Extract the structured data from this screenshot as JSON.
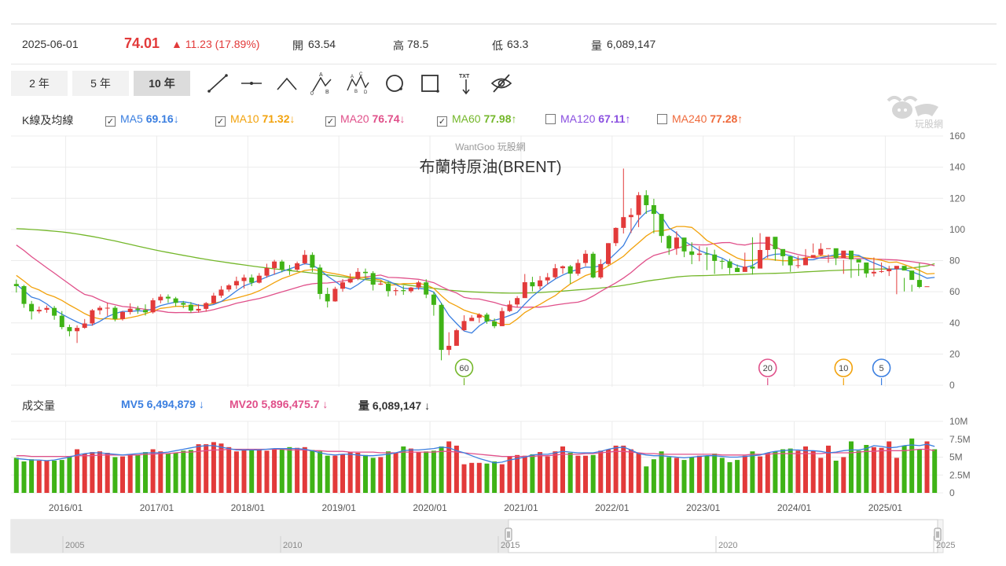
{
  "quote": {
    "date": "2025-06-01",
    "price": "74.01",
    "change": "▲ 11.23 (17.89%)",
    "open_label": "開",
    "open": "63.54",
    "high_label": "高",
    "high": "78.5",
    "low_label": "低",
    "low": "63.3",
    "vol_label": "量",
    "volume": "6,089,147"
  },
  "ranges": [
    {
      "label": "2 年",
      "active": false
    },
    {
      "label": "5 年",
      "active": false
    },
    {
      "label": "10 年",
      "active": true
    }
  ],
  "tools": [
    "line-icon",
    "horizontal-line-icon",
    "wedge-icon",
    "abc-pattern-icon",
    "abcd-pattern-icon",
    "circle-icon",
    "rectangle-icon",
    "text-tool-icon",
    "hide-icon"
  ],
  "tool_text": {
    "txt": "TXT",
    "a": "A",
    "b": "B",
    "c": "C",
    "d": "D",
    "zero": "0"
  },
  "ma_legend": {
    "label": "K線及均線",
    "items": [
      {
        "name": "MA5",
        "value": "69.16",
        "arrow": "↓",
        "checked": true,
        "color": "#3b7fe0"
      },
      {
        "name": "MA10",
        "value": "71.32",
        "arrow": "↓",
        "checked": true,
        "color": "#f2a20c"
      },
      {
        "name": "MA20",
        "value": "76.74",
        "arrow": "↓",
        "checked": true,
        "color": "#e0508a"
      },
      {
        "name": "MA60",
        "value": "77.98",
        "arrow": "↑",
        "checked": true,
        "color": "#74b72a"
      },
      {
        "name": "MA120",
        "value": "67.11",
        "arrow": "↑",
        "checked": false,
        "color": "#8a4fe0"
      },
      {
        "name": "MA240",
        "value": "77.28",
        "arrow": "↑",
        "checked": false,
        "color": "#ef6a3c"
      }
    ]
  },
  "watermark": {
    "site": "WantGoo 玩股網",
    "logo_text": "玩股網"
  },
  "volume_legend": {
    "label": "成交量",
    "mv5": "MV5 6,494,879",
    "mv5_arrow": "↓",
    "mv5_color": "#3b7fe0",
    "mv20": "MV20 5,896,475.7",
    "mv20_arrow": "↓",
    "mv20_color": "#e0508a",
    "vol": "量 6,089,147",
    "vol_arrow": "↓"
  },
  "colors": {
    "up": "#e23a3a",
    "down": "#3fb316",
    "grid": "#ececec"
  },
  "chart_data": {
    "type": "candlestick",
    "title": "布蘭特原油(BRENT)",
    "period": "monthly",
    "price_axis": {
      "min": 0,
      "max": 160,
      "ticks": [
        0,
        20,
        40,
        60,
        80,
        100,
        120,
        140,
        160
      ]
    },
    "volume_axis": {
      "min": 0,
      "max": 10000000,
      "ticks": [
        "0",
        "2.5M",
        "5M",
        "7.5M",
        "10M"
      ]
    },
    "x_axis": {
      "start": "2015-06",
      "end": "2025-06",
      "labels": [
        "2016/01",
        "2017/01",
        "2018/01",
        "2019/01",
        "2020/01",
        "2021/01",
        "2022/01",
        "2023/01",
        "2024/01",
        "2025/01"
      ]
    },
    "navigator_labels": [
      "2005",
      "2010",
      "2015",
      "2020",
      "2025"
    ],
    "closes": [
      63.6,
      52.2,
      47.4,
      48.4,
      49.6,
      44.6,
      37.3,
      34.7,
      36.8,
      39.6,
      48.1,
      49.7,
      49.7,
      42.5,
      47.0,
      49.1,
      48.3,
      46.8,
      54.5,
      56.8,
      55.7,
      52.8,
      51.7,
      47.9,
      49.0,
      52.7,
      57.5,
      61.4,
      64.1,
      66.9,
      69.1,
      65.8,
      70.3,
      75.2,
      79.4,
      74.3,
      74.2,
      78.3,
      83.7,
      75.5,
      58.6,
      53.8,
      61.9,
      66.0,
      68.4,
      72.8,
      72.0,
      64.6,
      65.2,
      60.4,
      61.0,
      60.4,
      62.7,
      66.0,
      58.2,
      51.6,
      22.7,
      25.3,
      35.3,
      41.2,
      43.3,
      45.3,
      40.9,
      37.9,
      47.6,
      51.8,
      55.9,
      66.1,
      63.5,
      67.3,
      69.3,
      75.1,
      76.3,
      71.6,
      78.5,
      84.4,
      69.2,
      77.8,
      91.2,
      101.0,
      107.9,
      109.3,
      122.0,
      115.6,
      110.0,
      95.8,
      87.9,
      94.8,
      85.9,
      83.7,
      84.5,
      83.9,
      79.8,
      79.5,
      75.3,
      72.7,
      76.1,
      74.9,
      86.8,
      95.3,
      87.4,
      82.8,
      77.0,
      77.0,
      81.7,
      83.6,
      87.5,
      87.9,
      81.6,
      86.4,
      80.8,
      78.8,
      71.8,
      72.8,
      73.2,
      74.6,
      76.6,
      73.6,
      67.6,
      63.1,
      63.5,
      74.0
    ],
    "opens": [
      65.0,
      63.6,
      52.2,
      47.4,
      48.4,
      49.6,
      44.6,
      37.3,
      34.7,
      36.8,
      39.6,
      48.1,
      49.7,
      49.7,
      42.5,
      47.0,
      49.1,
      48.3,
      46.8,
      54.5,
      56.8,
      55.7,
      52.8,
      51.7,
      47.9,
      49.0,
      52.7,
      57.5,
      61.4,
      64.1,
      66.9,
      69.1,
      65.8,
      70.3,
      75.2,
      79.4,
      74.3,
      74.2,
      78.3,
      83.7,
      75.5,
      58.6,
      53.8,
      61.9,
      66.0,
      68.4,
      72.8,
      72.0,
      64.6,
      65.2,
      60.4,
      61.0,
      60.4,
      62.7,
      66.0,
      58.2,
      51.6,
      22.7,
      25.3,
      35.3,
      41.2,
      43.3,
      45.3,
      40.9,
      37.9,
      47.6,
      51.8,
      55.9,
      66.1,
      63.5,
      67.3,
      69.3,
      75.1,
      76.3,
      71.6,
      78.5,
      84.4,
      69.2,
      77.8,
      91.2,
      101.0,
      107.9,
      109.3,
      122.0,
      115.6,
      110.0,
      95.8,
      87.9,
      94.8,
      85.9,
      83.7,
      84.5,
      83.9,
      79.8,
      79.5,
      75.3,
      72.7,
      76.1,
      74.9,
      86.8,
      95.3,
      87.4,
      82.8,
      77.0,
      77.0,
      81.7,
      83.6,
      87.5,
      87.9,
      81.6,
      86.4,
      80.8,
      78.8,
      71.8,
      72.8,
      73.2,
      74.6,
      76.6,
      73.6,
      67.6,
      63.5
    ],
    "highs": [
      67.8,
      64.4,
      54.1,
      50.5,
      51.1,
      50.9,
      47.6,
      38.9,
      38.4,
      42.5,
      48.9,
      51.0,
      52.9,
      50.9,
      47.6,
      52.6,
      50.9,
      51.9,
      55.9,
      58.4,
      58.3,
      56.7,
      54.1,
      53.4,
      52.0,
      53.4,
      59.3,
      63.7,
      65.0,
      69.7,
      71.0,
      71.1,
      72.0,
      78.0,
      80.5,
      80.5,
      77.2,
      79.4,
      86.7,
      85.3,
      77.5,
      62.6,
      63.2,
      68.2,
      71.7,
      75.2,
      74.9,
      73.2,
      67.2,
      66.7,
      62.5,
      63.9,
      63.1,
      67.2,
      68.0,
      59.9,
      52.9,
      34.0,
      36.2,
      44.9,
      44.9,
      46.2,
      46.5,
      42.8,
      49.8,
      54.3,
      57.2,
      71.4,
      69.6,
      70.1,
      72.0,
      77.8,
      76.9,
      77.2,
      80.8,
      86.7,
      85.6,
      80.9,
      91.2,
      101.3,
      139.1,
      113.6,
      124.0,
      125.2,
      119.7,
      103.6,
      96.5,
      98.8,
      93.2,
      91.8,
      89.3,
      88.6,
      87.0,
      81.2,
      81.1,
      77.5,
      85.1,
      95.0,
      97.6,
      90.8,
      87.4,
      84.2,
      79.3,
      83.0,
      87.4,
      91.0,
      91.2,
      84.0,
      87.2,
      80.4,
      81.6,
      78.0,
      75.0,
      82.0,
      78.8,
      76.6,
      75.3,
      68.9,
      64.5,
      78.5
    ],
    "lows": [
      59.5,
      49.7,
      42.2,
      46.1,
      46.5,
      42.0,
      35.9,
      31.4,
      27.1,
      36.2,
      38.2,
      45.4,
      44.5,
      41.0,
      41.5,
      45.4,
      45.8,
      44.7,
      46.0,
      52.6,
      52.9,
      50.5,
      49.4,
      46.6,
      46.6,
      47.2,
      52.1,
      56.1,
      60.0,
      61.8,
      62.1,
      63.6,
      65.3,
      69.0,
      71.0,
      72.5,
      70.8,
      73.1,
      77.5,
      72.6,
      55.2,
      49.9,
      53.6,
      60.0,
      65.4,
      67.4,
      68.0,
      60.8,
      64.3,
      56.9,
      57.6,
      58.0,
      59.3,
      61.3,
      55.9,
      44.6,
      15.98,
      19.3,
      31.9,
      35.0,
      41.5,
      40.1,
      39.4,
      36.6,
      37.9,
      47.0,
      50.1,
      57.2,
      60.2,
      61.5,
      64.6,
      68.3,
      71.5,
      65.0,
      70.3,
      76.4,
      68.6,
      68.2,
      76.8,
      89.3,
      97.4,
      97.7,
      101.5,
      110.0,
      97.5,
      91.5,
      83.7,
      83.7,
      82.2,
      77.7,
      79.6,
      73.9,
      71.4,
      74.5,
      71.4,
      73.4,
      75.0,
      71.0,
      86.2,
      81.6,
      79.9,
      76.8,
      72.8,
      75.1,
      77.1,
      85.0,
      82.8,
      78.6,
      77.1,
      71.5,
      68.9,
      70.1,
      69.1,
      69.8,
      72.1,
      70.1,
      58.4,
      60.2,
      60.1,
      62.3
    ],
    "ma5": [
      64.8,
      60.7,
      56.6,
      55.1,
      52.2,
      48.4,
      45.6,
      43.0,
      40.6,
      38.6,
      38.6,
      41.0,
      44.0,
      46.0,
      47.4,
      47.4,
      47.8,
      47.5,
      49.1,
      51.1,
      52.3,
      53.4,
      53.6,
      52.8,
      51.4,
      50.8,
      51.8,
      53.7,
      56.9,
      60.5,
      63.8,
      65.5,
      67.4,
      69.5,
      71.2,
      73.0,
      74.7,
      76.3,
      78.0,
      77.2,
      74.1,
      70.0,
      66.7,
      63.2,
      61.7,
      64.6,
      68.2,
      68.8,
      68.6,
      67.0,
      64.6,
      62.3,
      61.9,
      62.2,
      61.7,
      59.8,
      52.6,
      44.8,
      39.6,
      34.8,
      33.5,
      38.1,
      41.2,
      41.7,
      43.0,
      44.7,
      46.8,
      52.1,
      57.0,
      61.0,
      64.9,
      68.2,
      70.7,
      72.9,
      74.3,
      75.8,
      75.7,
      76.7,
      80.3,
      84.9,
      89.7,
      98.8,
      106.3,
      111.2,
      113.0,
      108.5,
      101.0,
      97.5,
      92.6,
      89.6,
      86.4,
      84.7,
      83.3,
      81.6,
      78.9,
      76.8,
      75.6,
      76.8,
      79.9,
      83.0,
      84.1,
      84.3,
      83.1,
      81.2,
      80.5,
      80.6,
      81.9,
      82.8,
      83.8,
      84.4,
      83.9,
      83.4,
      80.6,
      78.5,
      76.5,
      74.2,
      74.8,
      74.4,
      72.9,
      71.0,
      68.7,
      69.2
    ],
    "ma10": [
      70.5,
      66.9,
      63.0,
      61.1,
      58.4,
      56.8,
      54.4,
      51.5,
      48.8,
      46.0,
      43.7,
      42.6,
      42.7,
      42.3,
      42.6,
      43.4,
      44.4,
      45.9,
      47.5,
      49.3,
      49.9,
      50.6,
      50.6,
      50.9,
      51.2,
      51.5,
      52.6,
      53.7,
      54.8,
      56.0,
      57.3,
      58.7,
      60.6,
      63.2,
      65.9,
      68.4,
      70.1,
      71.9,
      73.7,
      74.2,
      73.6,
      72.4,
      71.5,
      70.6,
      69.5,
      69.3,
      69.1,
      68.3,
      67.6,
      64.2,
      64.5,
      65.2,
      65.3,
      65.4,
      64.4,
      62.2,
      57.5,
      53.3,
      50.9,
      48.2,
      46.6,
      45.4,
      43.0,
      40.7,
      38.9,
      39.1,
      42.5,
      46.7,
      49.4,
      51.9,
      54.8,
      57.5,
      61.4,
      65.0,
      67.7,
      70.4,
      72.0,
      73.7,
      76.6,
      79.6,
      82.8,
      87.3,
      91.5,
      95.8,
      98.9,
      99.1,
      100.0,
      101.9,
      101.9,
      101.3,
      97.4,
      92.9,
      90.4,
      87.1,
      84.3,
      81.6,
      80.1,
      80.1,
      80.8,
      81.0,
      80.4,
      79.9,
      79.9,
      80.6,
      81.8,
      82.3,
      83.1,
      82.9,
      82.5,
      82.5,
      82.3,
      82.6,
      81.7,
      81.1,
      80.2,
      78.8,
      79.1,
      77.5,
      75.7,
      73.7,
      71.4,
      71.7
    ],
    "ma20": [
      90.0,
      86.5,
      82.5,
      79.0,
      75.4,
      72.0,
      68.4,
      64.9,
      61.4,
      58.3,
      57.1,
      54.8,
      52.8,
      51.7,
      50.5,
      50.1,
      49.4,
      48.7,
      48.1,
      47.6,
      46.8,
      46.6,
      46.7,
      46.6,
      46.9,
      47.5,
      48.5,
      49.8,
      51.1,
      52.6,
      53.6,
      54.7,
      55.6,
      57.0,
      58.5,
      59.9,
      61.3,
      62.8,
      64.2,
      65.1,
      65.5,
      65.6,
      66.1,
      66.9,
      67.7,
      68.8,
      69.6,
      70.1,
      70.7,
      69.2,
      69.1,
      68.8,
      68.4,
      68.0,
      67.0,
      65.8,
      63.3,
      61.0,
      59.2,
      56.4,
      55.5,
      55.3,
      54.2,
      53.1,
      51.6,
      50.6,
      50.0,
      50.0,
      50.1,
      50.1,
      50.7,
      51.5,
      52.2,
      52.8,
      53.3,
      54.7,
      57.3,
      60.2,
      63.0,
      65.7,
      68.8,
      72.3,
      76.5,
      80.4,
      83.3,
      84.7,
      86.0,
      87.8,
      89.2,
      90.4,
      90.1,
      90.1,
      90.9,
      91.5,
      91.6,
      90.4,
      90.0,
      91.0,
      91.3,
      91.2,
      88.9,
      86.4,
      85.2,
      83.9,
      83.0,
      82.0,
      81.6,
      81.5,
      81.7,
      81.7,
      81.2,
      81.3,
      81.2,
      81.0,
      80.8,
      80.6,
      80.4,
      79.9,
      79.3,
      78.6,
      77.9,
      76.7
    ],
    "ma60": [
      100.5,
      100.3,
      100.0,
      99.7,
      99.3,
      98.9,
      98.4,
      97.8,
      97.1,
      96.3,
      95.5,
      94.6,
      93.6,
      92.6,
      91.5,
      90.4,
      89.3,
      88.2,
      87.1,
      86.1,
      85.2,
      84.3,
      83.4,
      82.5,
      81.6,
      80.8,
      80.0,
      79.3,
      78.6,
      77.9,
      77.2,
      76.5,
      75.9,
      75.3,
      74.7,
      74.2,
      73.6,
      73.1,
      72.6,
      72.0,
      71.4,
      70.8,
      70.2,
      69.6,
      69.0,
      68.4,
      67.8,
      67.2,
      66.5,
      65.9,
      65.2,
      64.6,
      64.0,
      63.4,
      62.8,
      62.2,
      61.6,
      61.0,
      60.6,
      60.2,
      59.9,
      59.7,
      59.5,
      59.3,
      59.2,
      59.1,
      59.1,
      59.2,
      59.3,
      59.5,
      59.8,
      60.1,
      60.4,
      60.8,
      61.2,
      61.6,
      62.0,
      62.4,
      62.9,
      63.4,
      64.1,
      64.9,
      65.8,
      66.8,
      67.5,
      68.1,
      68.8,
      69.5,
      69.9,
      70.2,
      70.3,
      70.4,
      70.6,
      70.8,
      70.9,
      71.0,
      71.2,
      71.4,
      71.6,
      71.7,
      71.8,
      72.0,
      72.2,
      72.5,
      72.8,
      73.0,
      73.3,
      73.5,
      73.7,
      73.9,
      74.1,
      74.2,
      74.4,
      74.5,
      74.6,
      74.6,
      74.6,
      74.8,
      75.3,
      75.9,
      76.6,
      78.0
    ],
    "volumes_m": [
      4.9,
      4.4,
      4.7,
      4.5,
      4.5,
      4.5,
      4.6,
      5.1,
      6.1,
      5.5,
      5.7,
      5.8,
      5.6,
      5.0,
      5.1,
      5.4,
      5.3,
      5.7,
      6.1,
      5.8,
      5.5,
      5.6,
      5.9,
      6.0,
      6.8,
      6.8,
      7.1,
      6.9,
      6.4,
      5.8,
      6.1,
      6.0,
      6.1,
      5.9,
      6.1,
      6.1,
      6.4,
      6.3,
      6.4,
      6.0,
      5.8,
      5.2,
      5.2,
      5.4,
      5.7,
      5.6,
      5.3,
      4.9,
      5.0,
      5.8,
      5.6,
      6.5,
      6.2,
      5.7,
      5.8,
      5.9,
      6.5,
      7.2,
      6.6,
      4.0,
      4.2,
      4.2,
      4.1,
      4.4,
      4.0,
      5.1,
      5.3,
      5.2,
      5.4,
      5.7,
      5.1,
      5.8,
      6.5,
      5.6,
      5.2,
      5.2,
      5.3,
      5.9,
      6.1,
      6.6,
      6.6,
      6.1,
      5.6,
      3.7,
      4.7,
      5.8,
      5.0,
      4.9,
      4.6,
      5.0,
      5.2,
      5.2,
      5.5,
      4.9,
      4.3,
      4.6,
      5.2,
      5.8,
      5.1,
      5.6,
      5.8,
      6.1,
      6.2,
      5.9,
      6.5,
      5.9,
      4.9,
      6.6,
      4.5,
      5.0,
      7.2,
      5.9,
      6.7,
      6.4,
      6.3,
      7.2,
      4.9,
      6.6,
      7.6,
      6.1,
      7.2,
      6.1
    ],
    "mv5_m": [
      4.8,
      4.7,
      4.6,
      4.6,
      4.5,
      4.6,
      4.8,
      5.0,
      5.3,
      5.5,
      5.6,
      5.6,
      5.5,
      5.4,
      5.3,
      5.4,
      5.5,
      5.6,
      5.6,
      5.6,
      5.7,
      5.9,
      6.1,
      6.3,
      6.5,
      6.6,
      6.6,
      6.4,
      6.2,
      6.0,
      6.0,
      6.0,
      6.0,
      6.1,
      6.2,
      6.2,
      6.2,
      6.2,
      6.1,
      5.9,
      5.6,
      5.4,
      5.3,
      5.4,
      5.4,
      5.3,
      5.2,
      5.2,
      5.3,
      5.4,
      5.6,
      5.9,
      6.0,
      6.0,
      6.1,
      6.2,
      6.4,
      6.3,
      5.9,
      5.6,
      5.2,
      4.8,
      4.5,
      4.2,
      4.3,
      4.6,
      4.8,
      5.0,
      5.3,
      5.4,
      5.4,
      5.6,
      5.8,
      5.7,
      5.6,
      5.6,
      5.6,
      5.8,
      6.1,
      6.3,
      6.4,
      6.0,
      5.5,
      5.3,
      5.2,
      5.2,
      5.1,
      5.0,
      4.9,
      5.0,
      5.1,
      5.2,
      5.2,
      5.1,
      5.0,
      5.0,
      5.1,
      5.2,
      5.3,
      5.6,
      5.8,
      5.9,
      6.0,
      6.0,
      5.9,
      5.9,
      5.8,
      5.6,
      5.7,
      5.9,
      6.0,
      6.0,
      6.2,
      6.6,
      6.5,
      6.3,
      6.4,
      6.6,
      6.7,
      6.6,
      6.8,
      6.5
    ],
    "mv20_m": [
      5.2,
      5.2,
      5.1,
      5.1,
      5.1,
      5.1,
      5.1,
      5.1,
      5.2,
      5.2,
      5.2,
      5.3,
      5.3,
      5.3,
      5.3,
      5.3,
      5.3,
      5.4,
      5.4,
      5.5,
      5.5,
      5.6,
      5.7,
      5.7,
      5.8,
      5.9,
      6.0,
      6.0,
      6.1,
      6.1,
      6.1,
      6.1,
      6.1,
      6.1,
      6.1,
      6.1,
      6.0,
      6.0,
      6.0,
      5.9,
      5.9,
      5.8,
      5.8,
      5.8,
      5.7,
      5.7,
      5.7,
      5.7,
      5.6,
      5.6,
      5.6,
      5.7,
      5.7,
      5.7,
      5.7,
      5.7,
      5.8,
      5.8,
      5.7,
      5.6,
      5.5,
      5.4,
      5.3,
      5.2,
      5.1,
      5.1,
      5.1,
      5.1,
      5.1,
      5.2,
      5.2,
      5.3,
      5.4,
      5.4,
      5.4,
      5.5,
      5.5,
      5.6,
      5.7,
      5.8,
      5.8,
      5.7,
      5.6,
      5.5,
      5.5,
      5.4,
      5.4,
      5.4,
      5.4,
      5.4,
      5.4,
      5.4,
      5.4,
      5.3,
      5.3,
      5.3,
      5.3,
      5.4,
      5.4,
      5.4,
      5.5,
      5.5,
      5.5,
      5.5,
      5.5,
      5.5,
      5.5,
      5.6,
      5.6,
      5.6,
      5.6,
      5.7,
      5.8,
      5.8,
      5.9,
      5.9,
      5.9,
      5.9,
      6.0,
      6.1,
      6.1,
      5.9
    ],
    "markers": [
      {
        "label": "60",
        "index": 59,
        "color": "#74b72a"
      },
      {
        "label": "20",
        "index": 99,
        "color": "#e0508a"
      },
      {
        "label": "10",
        "index": 109,
        "color": "#f2a20c"
      },
      {
        "label": "5",
        "index": 114,
        "color": "#3b7fe0"
      }
    ]
  }
}
